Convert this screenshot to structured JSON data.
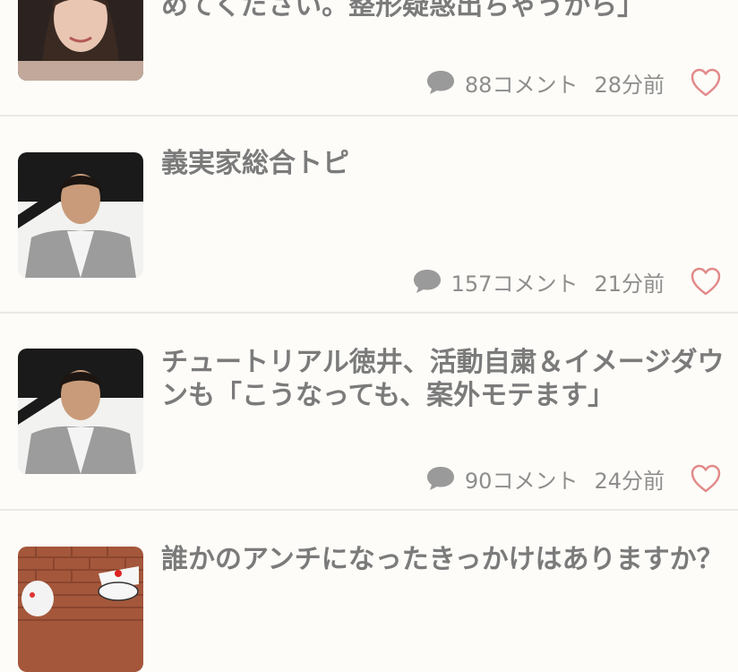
{
  "topics": [
    {
      "title": "めてください。整形疑惑出ちゃうから」",
      "comments": "88コメント",
      "time": "28分前"
    },
    {
      "title": "義実家総合トピ",
      "comments": "157コメント",
      "time": "21分前"
    },
    {
      "title": "チュートリアル徳井、活動自粛＆イメージダウンも「こうなっても、案外モテます」",
      "comments": "90コメント",
      "time": "24分前"
    },
    {
      "title": "誰かのアンチになったきっかけはありますか？"
    }
  ],
  "colors": {
    "text": "#7b7b7b",
    "meta": "#8d8d8d",
    "heart": "#e28a8a",
    "bubble": "#9a9a9a",
    "divider": "#ebe9e3",
    "background": "#fdfcf8"
  }
}
